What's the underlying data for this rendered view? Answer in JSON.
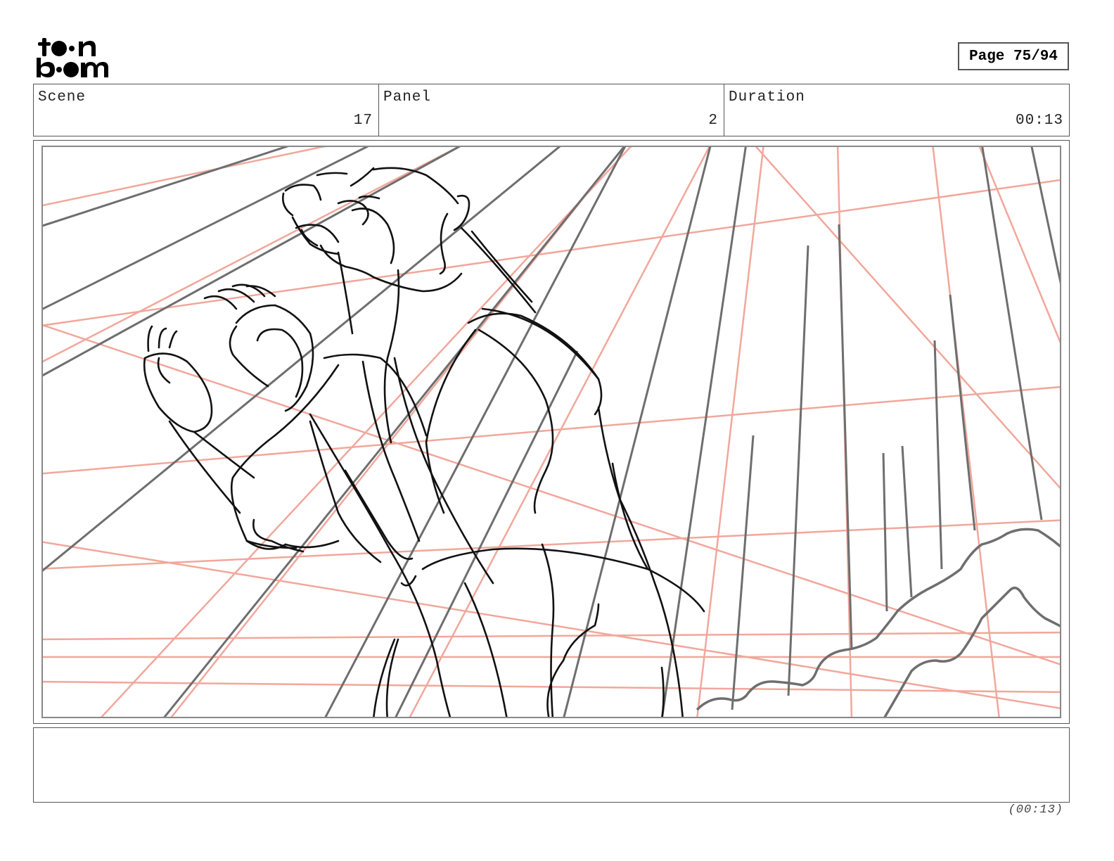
{
  "logo": {
    "line1": "toon",
    "line2": "boom"
  },
  "page": {
    "label": "Page 75/94"
  },
  "info": {
    "scene_label": "Scene",
    "scene_value": "17",
    "panel_label": "Panel",
    "panel_value": "2",
    "duration_label": "Duration",
    "duration_value": "00:13"
  },
  "panel": {
    "subject": "bear",
    "colors": {
      "pencil": "#111111",
      "perspective_grey": "#6e6e6e",
      "guide_red": "#f1a79b"
    }
  },
  "notes": {
    "text": ""
  },
  "footer": {
    "duration": "(00:13)"
  }
}
